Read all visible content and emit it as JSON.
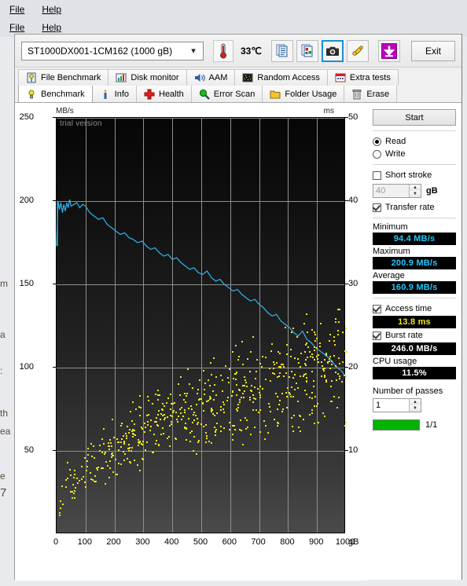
{
  "menubar": {
    "file": "File",
    "help": "Help"
  },
  "toolbar": {
    "drive": "ST1000DX001-1CM162 (1000 gB)",
    "temperature": "33℃",
    "exit_label": "Exit",
    "buttons": [
      {
        "name": "copy-text-icon",
        "title": "Copy text"
      },
      {
        "name": "copy-image-icon",
        "title": "Copy image"
      },
      {
        "name": "camera-icon",
        "title": "Screenshot",
        "active": true
      },
      {
        "name": "tools-icon",
        "title": "Tools"
      },
      {
        "name": "download-icon",
        "title": "Download"
      }
    ]
  },
  "tabs": {
    "row1": [
      {
        "label": "File Benchmark",
        "icon": "file-benchmark-icon",
        "selected": false
      },
      {
        "label": "Disk monitor",
        "icon": "disk-monitor-icon",
        "selected": false
      },
      {
        "label": "AAM",
        "icon": "aam-icon",
        "selected": false
      },
      {
        "label": "Random Access",
        "icon": "random-access-icon",
        "selected": false
      },
      {
        "label": "Extra tests",
        "icon": "extra-tests-icon",
        "selected": false
      }
    ],
    "row2": [
      {
        "label": "Benchmark",
        "icon": "benchmark-icon",
        "selected": true
      },
      {
        "label": "Info",
        "icon": "info-icon",
        "selected": false
      },
      {
        "label": "Health",
        "icon": "health-icon",
        "selected": false
      },
      {
        "label": "Error Scan",
        "icon": "error-scan-icon",
        "selected": false
      },
      {
        "label": "Folder Usage",
        "icon": "folder-usage-icon",
        "selected": false
      },
      {
        "label": "Erase",
        "icon": "erase-icon",
        "selected": false
      }
    ]
  },
  "sidebar": {
    "start_label": "Start",
    "mode": {
      "read": "Read",
      "write": "Write",
      "selected": "Read"
    },
    "short_stroke": {
      "label": "Short stroke",
      "checked": false,
      "value": "40",
      "unit": "gB"
    },
    "transfer_rate": {
      "label": "Transfer rate",
      "checked": true
    },
    "minimum": {
      "label": "Minimum",
      "value": "94.4 MB/s"
    },
    "maximum": {
      "label": "Maximum",
      "value": "200.9 MB/s"
    },
    "average": {
      "label": "Average",
      "value": "160.9 MB/s"
    },
    "access_time": {
      "label": "Access time",
      "checked": true,
      "value": "13.8 ms"
    },
    "burst_rate": {
      "label": "Burst rate",
      "checked": true,
      "value": "246.0 MB/s"
    },
    "cpu_usage": {
      "label": "CPU usage",
      "value": "11.5%"
    },
    "passes": {
      "label": "Number of passes",
      "value": "1"
    },
    "progress": {
      "text": "1/1",
      "percent": 100,
      "color": "#00b400"
    }
  },
  "colors": {
    "transfer_curve": "#2fb5ef",
    "access_dots": "#f2e61c",
    "value_text": "#1ec8ff",
    "access_text": "#f2e61c",
    "accent": "#1b8fd6"
  },
  "chart_data": {
    "type": "line",
    "title": "",
    "watermark": "trial version",
    "xlabel": "gB",
    "ylabel": "MB/s",
    "y2label": "ms",
    "xlim": [
      0,
      1000
    ],
    "ylim": [
      0,
      250
    ],
    "y2lim": [
      0,
      50
    ],
    "xticks": [
      0,
      100,
      200,
      300,
      400,
      500,
      600,
      700,
      800,
      900,
      1000
    ],
    "yticks": [
      50,
      100,
      150,
      200,
      250
    ],
    "y2ticks": [
      10,
      20,
      30,
      40,
      50
    ],
    "grid": true,
    "series": [
      {
        "name": "Transfer rate",
        "type": "line",
        "axis": "left",
        "unit": "MB/s",
        "color": "#2fb5ef",
        "x": [
          0,
          5,
          10,
          15,
          20,
          25,
          30,
          35,
          40,
          45,
          50,
          60,
          70,
          80,
          90,
          100,
          115,
          130,
          145,
          160,
          175,
          190,
          205,
          220,
          235,
          250,
          265,
          280,
          295,
          310,
          325,
          340,
          355,
          370,
          385,
          400,
          415,
          430,
          445,
          460,
          475,
          490,
          505,
          520,
          535,
          550,
          565,
          580,
          595,
          610,
          625,
          640,
          655,
          670,
          685,
          700,
          715,
          730,
          745,
          760,
          775,
          790,
          805,
          820,
          835,
          850,
          865,
          880,
          895,
          910,
          925,
          940,
          955,
          970,
          985,
          1000
        ],
        "y": [
          173,
          200,
          195,
          199,
          193,
          198,
          194,
          199,
          196,
          200.9,
          197,
          198,
          199,
          196,
          198,
          197,
          193,
          191,
          189,
          190,
          186,
          184,
          182,
          180,
          181,
          178,
          177,
          175,
          176,
          173,
          171,
          172,
          169,
          167,
          168,
          165,
          166,
          163,
          161,
          159,
          160,
          157,
          156,
          158,
          154,
          152,
          153,
          150,
          148,
          146,
          147,
          144,
          142,
          140,
          141,
          138,
          136,
          133,
          131,
          132,
          128,
          126,
          124,
          121,
          119,
          122,
          117,
          115,
          112,
          110,
          108,
          106,
          103,
          100,
          98,
          94.4
        ]
      },
      {
        "name": "Access time",
        "type": "scatter",
        "axis": "right",
        "unit": "ms",
        "color": "#f2e61c",
        "average": 13.8,
        "description": "Scattered access-time samples rising from ~3 ms near 0 gB to ~28 ms near 1000 gB"
      }
    ]
  },
  "desktop": {
    "fragments": [
      "m",
      "a",
      ":",
      "th",
      "ea",
      "e",
      "7"
    ]
  }
}
